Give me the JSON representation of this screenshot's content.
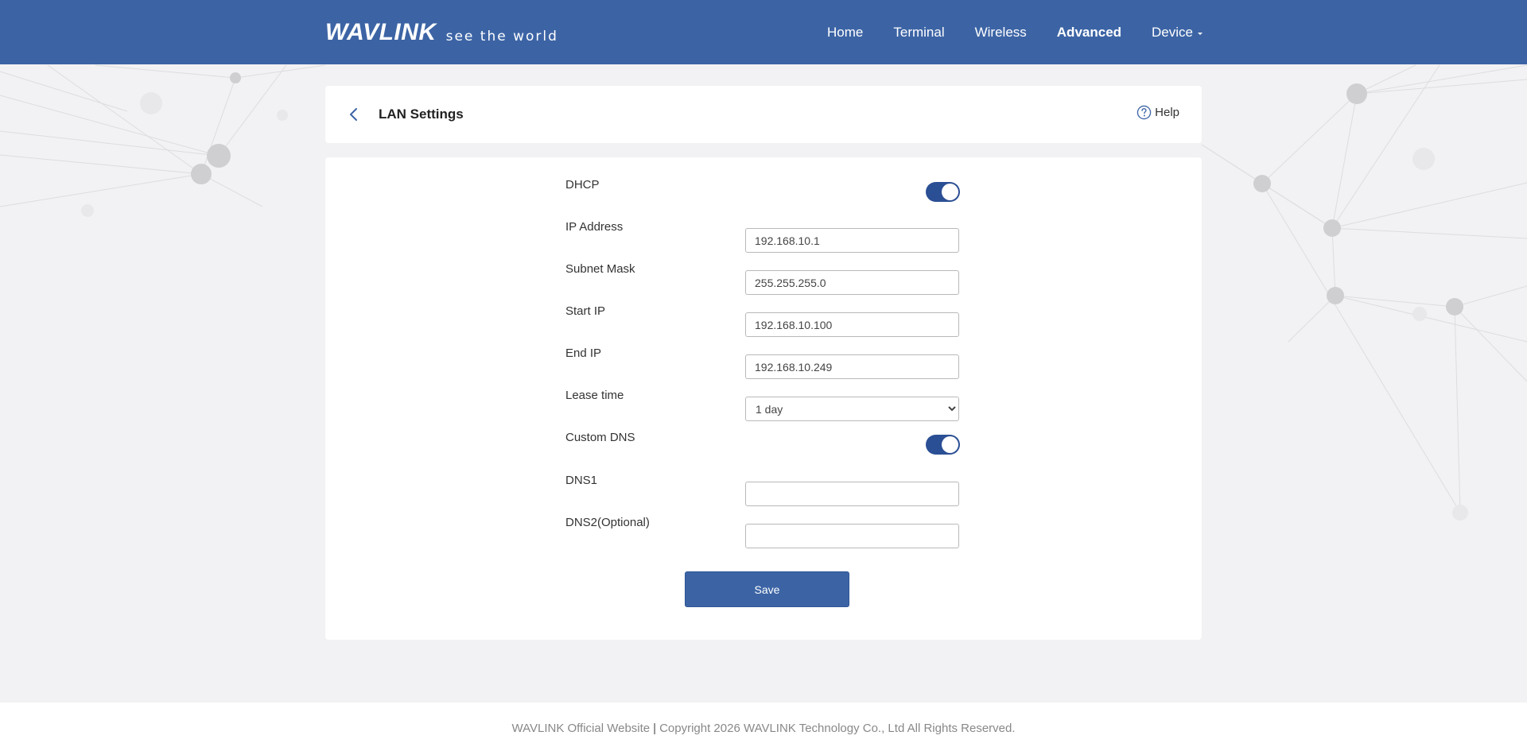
{
  "colors": {
    "header_bg": "#3c64a5",
    "toggle_on": "#2b4f94",
    "save_button": "#3c64a5"
  },
  "header": {
    "brand": "WAVLINK",
    "tagline": "see the world",
    "nav": [
      {
        "label": "Home",
        "active": false
      },
      {
        "label": "Terminal",
        "active": false
      },
      {
        "label": "Wireless",
        "active": false
      },
      {
        "label": "Advanced",
        "active": true
      },
      {
        "label": "Device",
        "active": false,
        "has_dropdown": true
      }
    ]
  },
  "page": {
    "title": "LAN Settings",
    "back_icon": "chevron-left-icon",
    "help_label": "Help",
    "help_icon": "question-circle-icon"
  },
  "form": {
    "dhcp": {
      "label": "DHCP",
      "enabled": true
    },
    "ip_address": {
      "label": "IP Address",
      "value": "192.168.10.1"
    },
    "subnet_mask": {
      "label": "Subnet Mask",
      "value": "255.255.255.0"
    },
    "start_ip": {
      "label": "Start IP",
      "value": "192.168.10.100"
    },
    "end_ip": {
      "label": "End IP",
      "value": "192.168.10.249"
    },
    "lease_time": {
      "label": "Lease time",
      "value": "1 day",
      "options": [
        "1 day"
      ]
    },
    "custom_dns": {
      "label": "Custom DNS",
      "enabled": true
    },
    "dns1": {
      "label": "DNS1",
      "value": ""
    },
    "dns2": {
      "label": "DNS2(Optional)",
      "value": ""
    },
    "save_label": "Save"
  },
  "footer": {
    "website_label": "WAVLINK Official Website",
    "separator": "|",
    "copyright": "Copyright 2026 WAVLINK Technology Co., Ltd All Rights Reserved."
  }
}
